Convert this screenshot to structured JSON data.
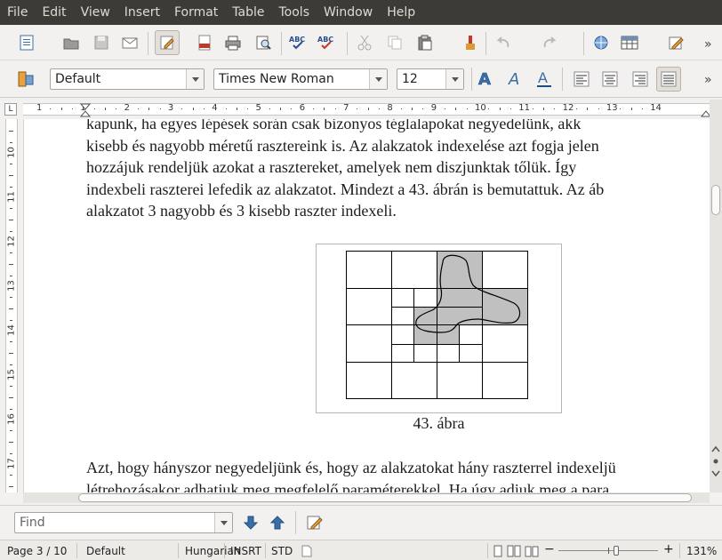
{
  "menu": [
    "File",
    "Edit",
    "View",
    "Insert",
    "Format",
    "Table",
    "Tools",
    "Window",
    "Help"
  ],
  "formatting": {
    "style": "Default",
    "font": "Times New Roman",
    "size": "12"
  },
  "ruler": {
    "h_numbers": [
      "1",
      "1",
      "2",
      "3",
      "4",
      "5",
      "6",
      "7",
      "8",
      "9",
      "10",
      "11",
      "12",
      "13",
      "14"
    ],
    "v_numbers": [
      "10",
      "11",
      "12",
      "13",
      "14",
      "15",
      "16",
      "17"
    ]
  },
  "document": {
    "lines_top": [
      "kapunk, ha egyes lépések során csak bizonyos téglalapokat negyedelünk, akk",
      "kisebb és nagyobb méretű rasztereink is. Az alakzatok indexelése azt fogja jelen",
      "hozzájuk rendeljük azokat a rasztereket, amelyek nem diszjunktak tőlük. Így",
      "indexbeli raszterei lefedik az alakzatot. Mindezt a 43. ábrán is bemutattuk. Az áb",
      "alakzatot 3 nagyobb és 3 kisebb raszter indexeli."
    ],
    "caption": "43. ábra",
    "lines_bottom": [
      "Azt, hogy hányszor negyedeljünk és, hogy az alakzatokat hány raszterrel indexeljü",
      "létrehozásakor adhatjuk meg megfelelő paraméterekkel. Ha úgy adjuk meg a para"
    ]
  },
  "find": {
    "placeholder": "Find"
  },
  "status": {
    "page": "Page 3 / 10",
    "style": "Default",
    "language": "Hungarian",
    "insert_mode": "INSRT",
    "selection_mode": "STD",
    "zoom": "131%"
  },
  "colors": {
    "menubar": "#3c3b37",
    "raster_fill": "#c0c0c0"
  }
}
